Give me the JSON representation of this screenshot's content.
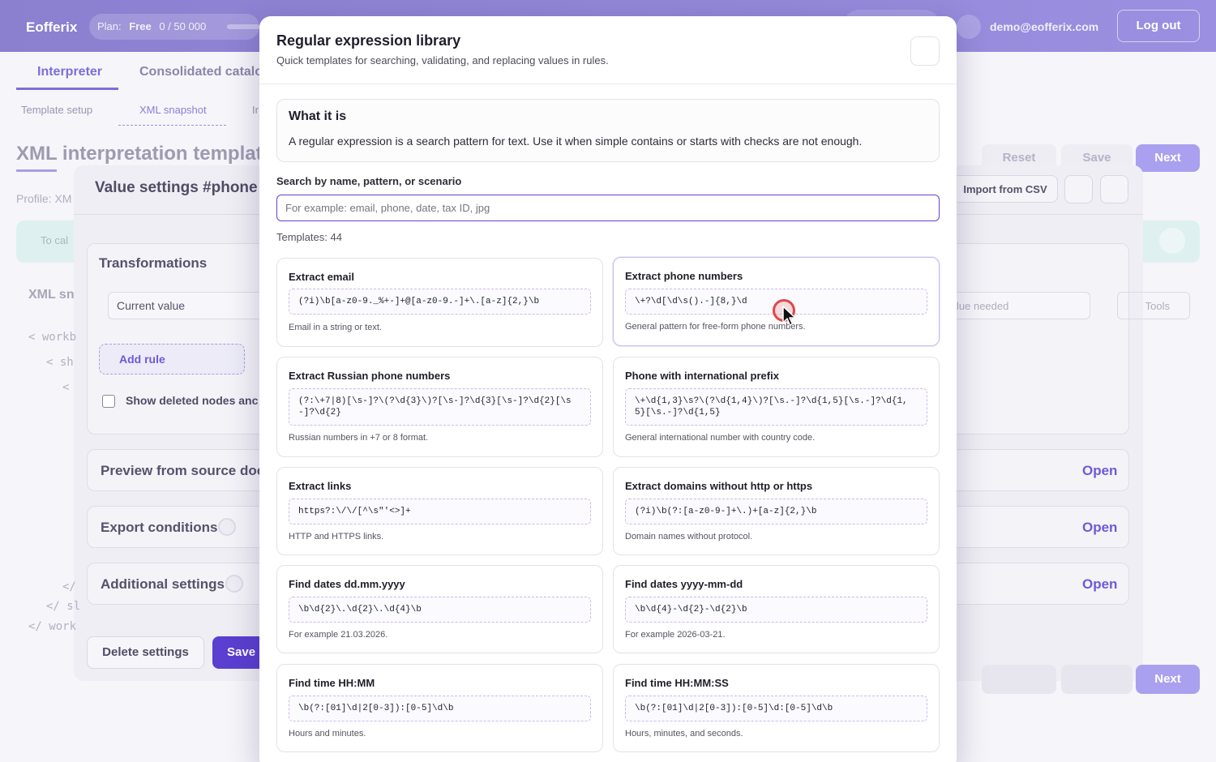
{
  "app": {
    "brand": "Eofferix",
    "plan_label": "Plan:",
    "plan_name": "Free",
    "plan_usage": "0 / 50 000",
    "user_email": "demo@eofferix.com",
    "logout_label": "Log out"
  },
  "main_tabs": [
    "Interpreter",
    "Consolidated catalo"
  ],
  "sub_tabs": [
    "Template setup",
    "XML snapshot",
    "Ir"
  ],
  "page": {
    "title": "XML interpretation templat",
    "profile": "Profile: XM",
    "reset": "Reset",
    "save": "Save",
    "next": "Next",
    "info_text": "To cal"
  },
  "panel": {
    "title": "Value settings #phone",
    "import_label": "Import from CSV",
    "transformations_title": "Transformations",
    "current_value": "Current value",
    "value_needed": "lue needed",
    "tools": "Tools",
    "add_rule": "Add rule",
    "show_deleted": "Show deleted nodes anc",
    "xml_title": "XML sn",
    "xml_lines": [
      "< workb",
      "< sh",
      "<",
      "</",
      "</ sl",
      "</ work"
    ],
    "sections": [
      {
        "title": "Preview from source docu",
        "open": "Open"
      },
      {
        "title": "Export conditions",
        "open": "Open"
      },
      {
        "title": "Additional settings",
        "open": "Open"
      }
    ],
    "delete_label": "Delete settings",
    "save_label": "Save",
    "bottom_next": "Next"
  },
  "modal": {
    "title": "Regular expression library",
    "subtitle": "Quick templates for searching, validating, and replacing values in rules.",
    "info_title": "What it is",
    "info_text": "A regular expression is a search pattern for text. Use it when simple contains or starts with checks are not enough.",
    "search_label": "Search by name, pattern, or scenario",
    "search_placeholder": "For example: email, phone, date, tax ID, jpg",
    "search_value": "",
    "templates_count": "Templates: 44",
    "templates": [
      {
        "title": "Extract email",
        "pattern": "(?i)\\b[a-z0-9._%+-]+@[a-z0-9.-]+\\.[a-z]{2,}\\b",
        "desc": "Email in a string or text."
      },
      {
        "title": "Extract phone numbers",
        "pattern": "\\+?\\d[\\d\\s().-]{8,}\\d",
        "desc": "General pattern for free-form phone numbers."
      },
      {
        "title": "Extract Russian phone numbers",
        "pattern": "(?:\\+7|8)[\\s-]?\\(?\\d{3}\\)?[\\s-]?\\d{3}[\\s-]?\\d{2}[\\s-]?\\d{2}",
        "desc": "Russian numbers in +7 or 8 format."
      },
      {
        "title": "Phone with international prefix",
        "pattern": "\\+\\d{1,3}\\s?\\(?\\d{1,4}\\)?[\\s.-]?\\d{1,5}[\\s.-]?\\d{1,5}[\\s.-]?\\d{1,5}",
        "desc": "General international number with country code."
      },
      {
        "title": "Extract links",
        "pattern": "https?:\\/\\/[^\\s\"'<>]+",
        "desc": "HTTP and HTTPS links."
      },
      {
        "title": "Extract domains without http or https",
        "pattern": "(?i)\\b(?:[a-z0-9-]+\\.)+[a-z]{2,}\\b",
        "desc": "Domain names without protocol."
      },
      {
        "title": "Find dates dd.mm.yyyy",
        "pattern": "\\b\\d{2}\\.\\d{2}\\.\\d{4}\\b",
        "desc": "For example 21.03.2026."
      },
      {
        "title": "Find dates yyyy-mm-dd",
        "pattern": "\\b\\d{4}-\\d{2}-\\d{2}\\b",
        "desc": "For example 2026-03-21."
      },
      {
        "title": "Find time HH:MM",
        "pattern": "\\b(?:[01]\\d|2[0-3]):[0-5]\\d\\b",
        "desc": "Hours and minutes."
      },
      {
        "title": "Find time HH:MM:SS",
        "pattern": "\\b(?:[01]\\d|2[0-3]):[0-5]\\d:[0-5]\\d\\b",
        "desc": "Hours, minutes, and seconds."
      }
    ]
  }
}
